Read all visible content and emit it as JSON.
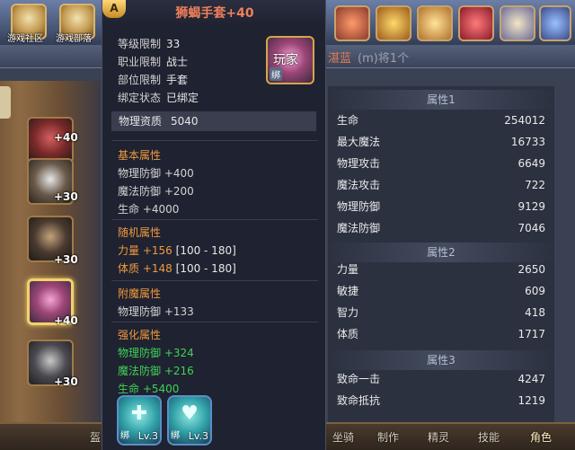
{
  "topbar": {
    "icon1_label": "游戏社区",
    "icon2_label": "游戏部落"
  },
  "header": {
    "player_name": "湛蓝",
    "extra": "(m)将1个"
  },
  "left_slots": [
    {
      "plus": "+40"
    },
    {
      "plus": "+30"
    },
    {
      "plus": "+30"
    },
    {
      "plus": "+40"
    },
    {
      "plus": "+30"
    }
  ],
  "stats": {
    "group1_title": "属性1",
    "group1": [
      {
        "name": "生命",
        "value": "254012"
      },
      {
        "name": "最大魔法",
        "value": "16733"
      },
      {
        "name": "物理攻击",
        "value": "6649"
      },
      {
        "name": "魔法攻击",
        "value": "722"
      },
      {
        "name": "物理防御",
        "value": "9129"
      },
      {
        "name": "魔法防御",
        "value": "7046"
      }
    ],
    "group2_title": "属性2",
    "group2": [
      {
        "name": "力量",
        "value": "2650"
      },
      {
        "name": "敏捷",
        "value": "609"
      },
      {
        "name": "智力",
        "value": "418"
      },
      {
        "name": "体质",
        "value": "1717"
      }
    ],
    "group3_title": "属性3",
    "group3": [
      {
        "name": "致命一击",
        "value": "4247"
      },
      {
        "name": "致命抵抗",
        "value": "1219"
      }
    ]
  },
  "bottom_tabs": [
    "盔",
    "坐骑",
    "制作",
    "精灵",
    "技能",
    "角色"
  ],
  "tooltip": {
    "badge": "A",
    "title": "狮蝎手套+40",
    "level_label": "等级限制",
    "level_value": "33",
    "class_label": "职业限制",
    "class_value": "战士",
    "slot_label": "部位限制",
    "slot_value": "手套",
    "bind_label": "绑定状态",
    "bind_value": "已绑定",
    "icon_text": "玩家",
    "icon_bind": "绑",
    "quality_label": "物理资质",
    "quality_value": "5040",
    "basic_title": "基本属性",
    "basic": [
      {
        "name": "物理防御",
        "value": "+400"
      },
      {
        "name": "魔法防御",
        "value": "+200"
      },
      {
        "name": "生命",
        "value": "+4000"
      }
    ],
    "random_title": "随机属性",
    "random": [
      {
        "name": "力量",
        "value": "+156",
        "range": "[100 - 180]"
      },
      {
        "name": "体质",
        "value": "+148",
        "range": "[100 - 180]"
      }
    ],
    "enchant_title": "附魔属性",
    "enchant": [
      {
        "name": "物理防御",
        "value": "+133"
      }
    ],
    "enhance_title": "强化属性",
    "enhance": [
      {
        "name": "物理防御",
        "value": "+324"
      },
      {
        "name": "魔法防御",
        "value": "+216"
      },
      {
        "name": "生命",
        "value": "+5400"
      }
    ],
    "gems": [
      {
        "bind": "绑",
        "level": "Lv.3",
        "glyph": "✚"
      },
      {
        "bind": "绑",
        "level": "Lv.3",
        "glyph": "♥"
      }
    ]
  }
}
